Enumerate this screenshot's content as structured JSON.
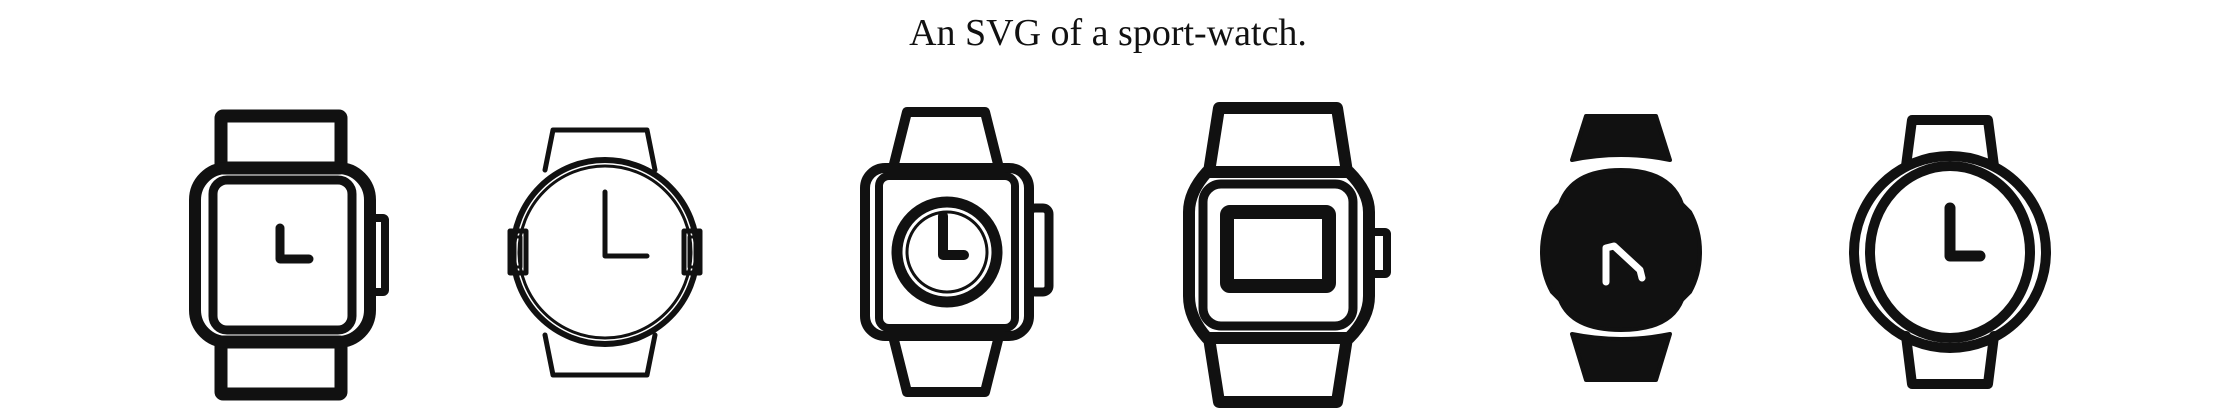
{
  "title": "An SVG of a sport-watch.",
  "colors": {
    "ink": "#111111",
    "background": "#ffffff"
  },
  "icons": [
    "square-watch-icon",
    "round-analog-watch-icon",
    "smartwatch-icon",
    "digital-watch-icon",
    "filled-round-watch-icon",
    "oval-watch-icon"
  ]
}
